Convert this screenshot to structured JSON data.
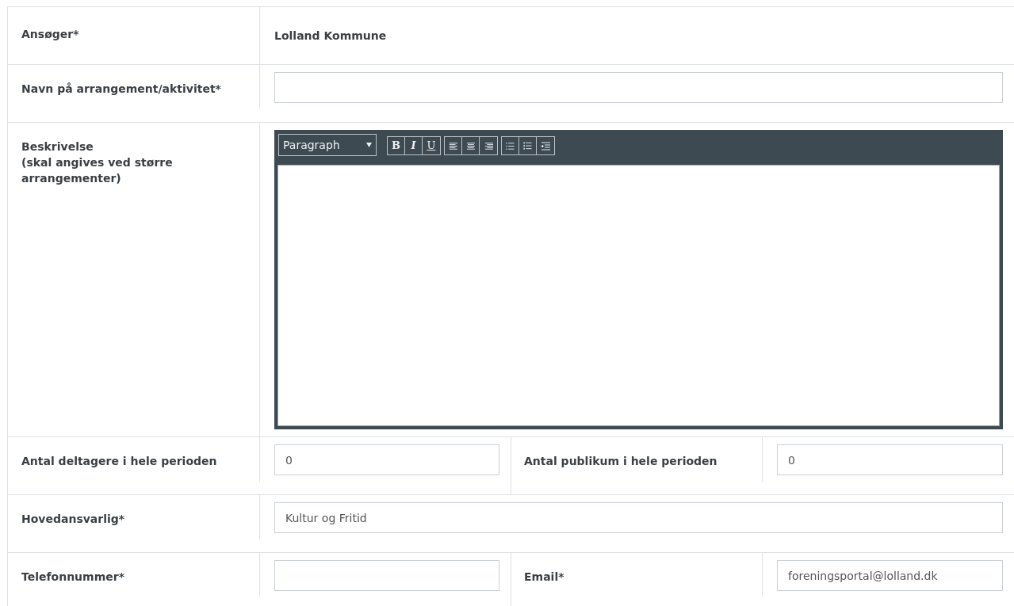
{
  "rows": [
    {
      "kind": "static",
      "label": "Ansøger*",
      "value": "Lolland Kommune"
    },
    {
      "kind": "input",
      "label": "Navn på arrangement/aktivitet*"
    },
    {
      "kind": "editor",
      "label": "Beskrivelse",
      "hint": "(skal angives ved større arrangementer)",
      "format": "Paragraph",
      "tool_groups": [
        [
          {
            "kind": "bold",
            "label": "B"
          },
          {
            "kind": "italic",
            "label": "I"
          },
          {
            "kind": "underline",
            "label": "U"
          }
        ],
        [
          {
            "kind": "align-left"
          },
          {
            "kind": "align-center"
          },
          {
            "kind": "align-right"
          }
        ],
        [
          {
            "kind": "bullet-list"
          },
          {
            "kind": "numbered-list"
          },
          {
            "kind": "indent"
          }
        ]
      ]
    },
    {
      "kind": "pair",
      "fields": [
        {
          "label": "Antal deltagere i hele perioden",
          "value": "0"
        },
        {
          "label": "Antal publikum i hele perioden",
          "value": "0"
        }
      ]
    },
    {
      "kind": "input",
      "label": "Hovedansvarlig*",
      "value": "Kultur og Fritid"
    },
    {
      "kind": "pair",
      "fields": [
        {
          "label": "Telefonnummer*"
        },
        {
          "label": "Email*",
          "value": "foreningsportal@lolland.dk"
        }
      ]
    }
  ]
}
